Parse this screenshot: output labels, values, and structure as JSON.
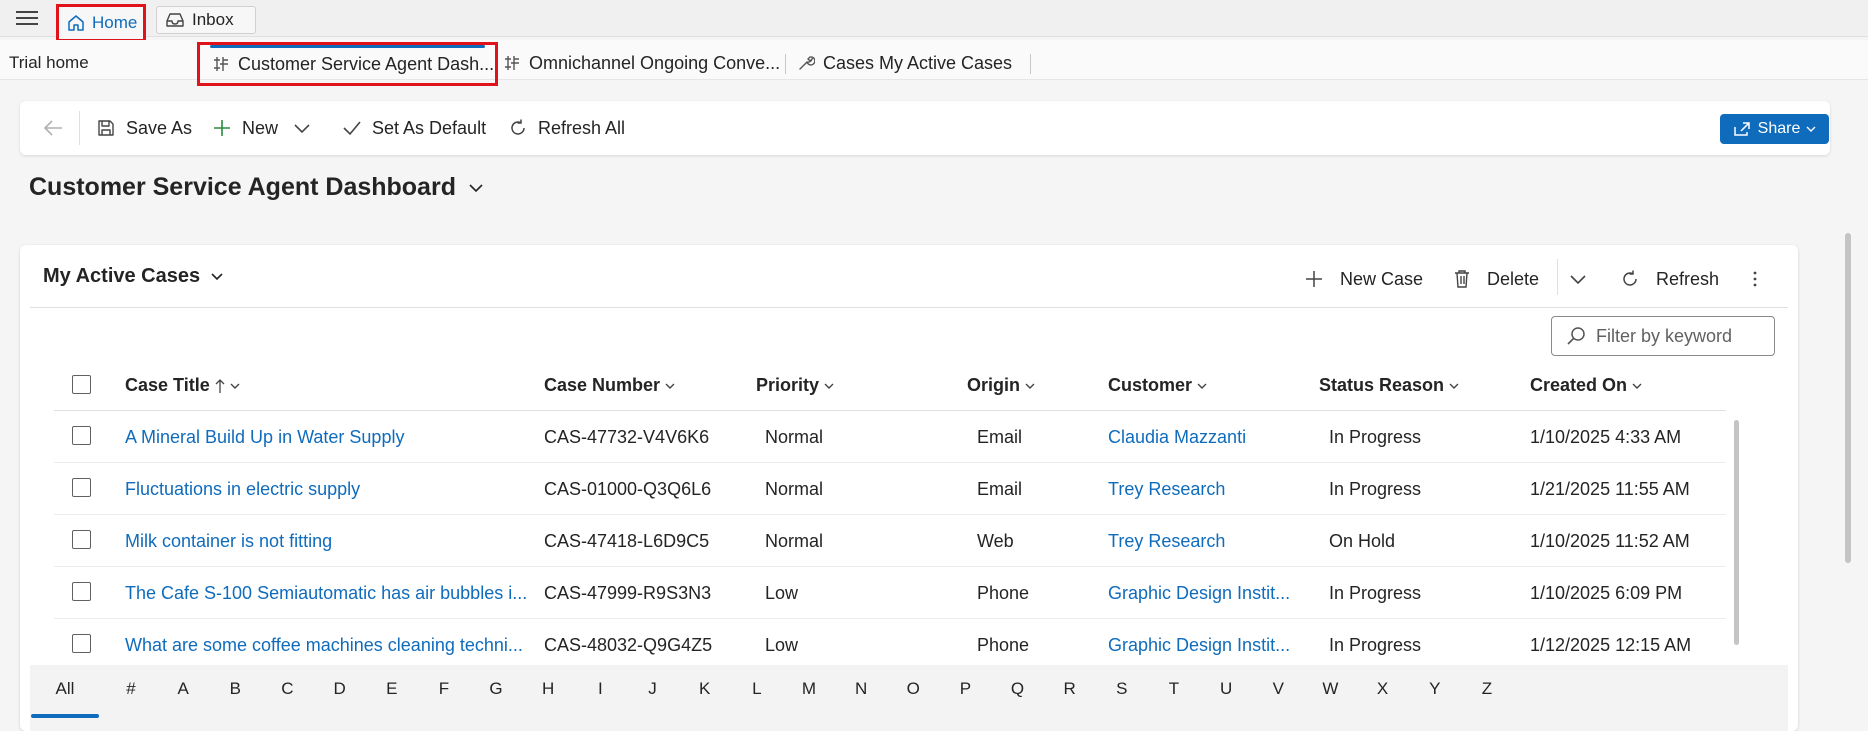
{
  "topbar": {
    "tabs": [
      {
        "label": "Home",
        "icon": "home-icon"
      },
      {
        "label": "Inbox",
        "icon": "inbox-icon"
      }
    ]
  },
  "session": {
    "trial_home": "Trial home",
    "tabs": [
      {
        "label": "Customer Service Agent Dash...",
        "icon": "dashboard-icon"
      },
      {
        "label": "Omnichannel Ongoing Conve...",
        "icon": "dashboard-icon"
      },
      {
        "label": "Cases My Active Cases",
        "icon": "wrench-icon"
      }
    ]
  },
  "commandbar": {
    "save_as": "Save As",
    "new": "New",
    "set_default": "Set As Default",
    "refresh_all": "Refresh All",
    "share": "Share"
  },
  "dashboard": {
    "title": "Customer Service Agent Dashboard"
  },
  "grid": {
    "title": "My Active Cases",
    "new_case": "New Case",
    "delete": "Delete",
    "refresh": "Refresh",
    "filter_placeholder": "Filter by keyword",
    "columns": [
      "Case Title",
      "Case Number",
      "Priority",
      "Origin",
      "Customer",
      "Status Reason",
      "Created On"
    ],
    "rows": [
      {
        "title": "A Mineral Build Up in Water Supply",
        "number": "CAS-47732-V4V6K6",
        "priority": "Normal",
        "origin": "Email",
        "customer": "Claudia Mazzanti",
        "status": "In Progress",
        "created": "1/10/2025 4:33 AM"
      },
      {
        "title": "Fluctuations in electric supply",
        "number": "CAS-01000-Q3Q6L6",
        "priority": "Normal",
        "origin": "Email",
        "customer": "Trey Research",
        "status": "In Progress",
        "created": "1/21/2025 11:55 AM"
      },
      {
        "title": "Milk container is not fitting",
        "number": "CAS-47418-L6D9C5",
        "priority": "Normal",
        "origin": "Web",
        "customer": "Trey Research",
        "status": "On Hold",
        "created": "1/10/2025 11:52 AM"
      },
      {
        "title": "The Cafe S-100 Semiautomatic has air bubbles i...",
        "number": "CAS-47999-R9S3N3",
        "priority": "Low",
        "origin": "Phone",
        "customer": "Graphic Design Instit...",
        "status": "In Progress",
        "created": "1/10/2025 6:09 PM"
      },
      {
        "title": "What are some coffee machines cleaning techni...",
        "number": "CAS-48032-Q9G4Z5",
        "priority": "Low",
        "origin": "Phone",
        "customer": "Graphic Design Instit...",
        "status": "In Progress",
        "created": "1/12/2025 12:15 AM"
      }
    ],
    "alphabet": [
      "All",
      "#",
      "A",
      "B",
      "C",
      "D",
      "E",
      "F",
      "G",
      "H",
      "I",
      "J",
      "K",
      "L",
      "M",
      "N",
      "O",
      "P",
      "Q",
      "R",
      "S",
      "T",
      "U",
      "V",
      "W",
      "X",
      "Y",
      "Z"
    ],
    "alphabet_selected": "All"
  },
  "colors": {
    "accent": "#0f6cbd",
    "highlight": "#e0131a"
  }
}
